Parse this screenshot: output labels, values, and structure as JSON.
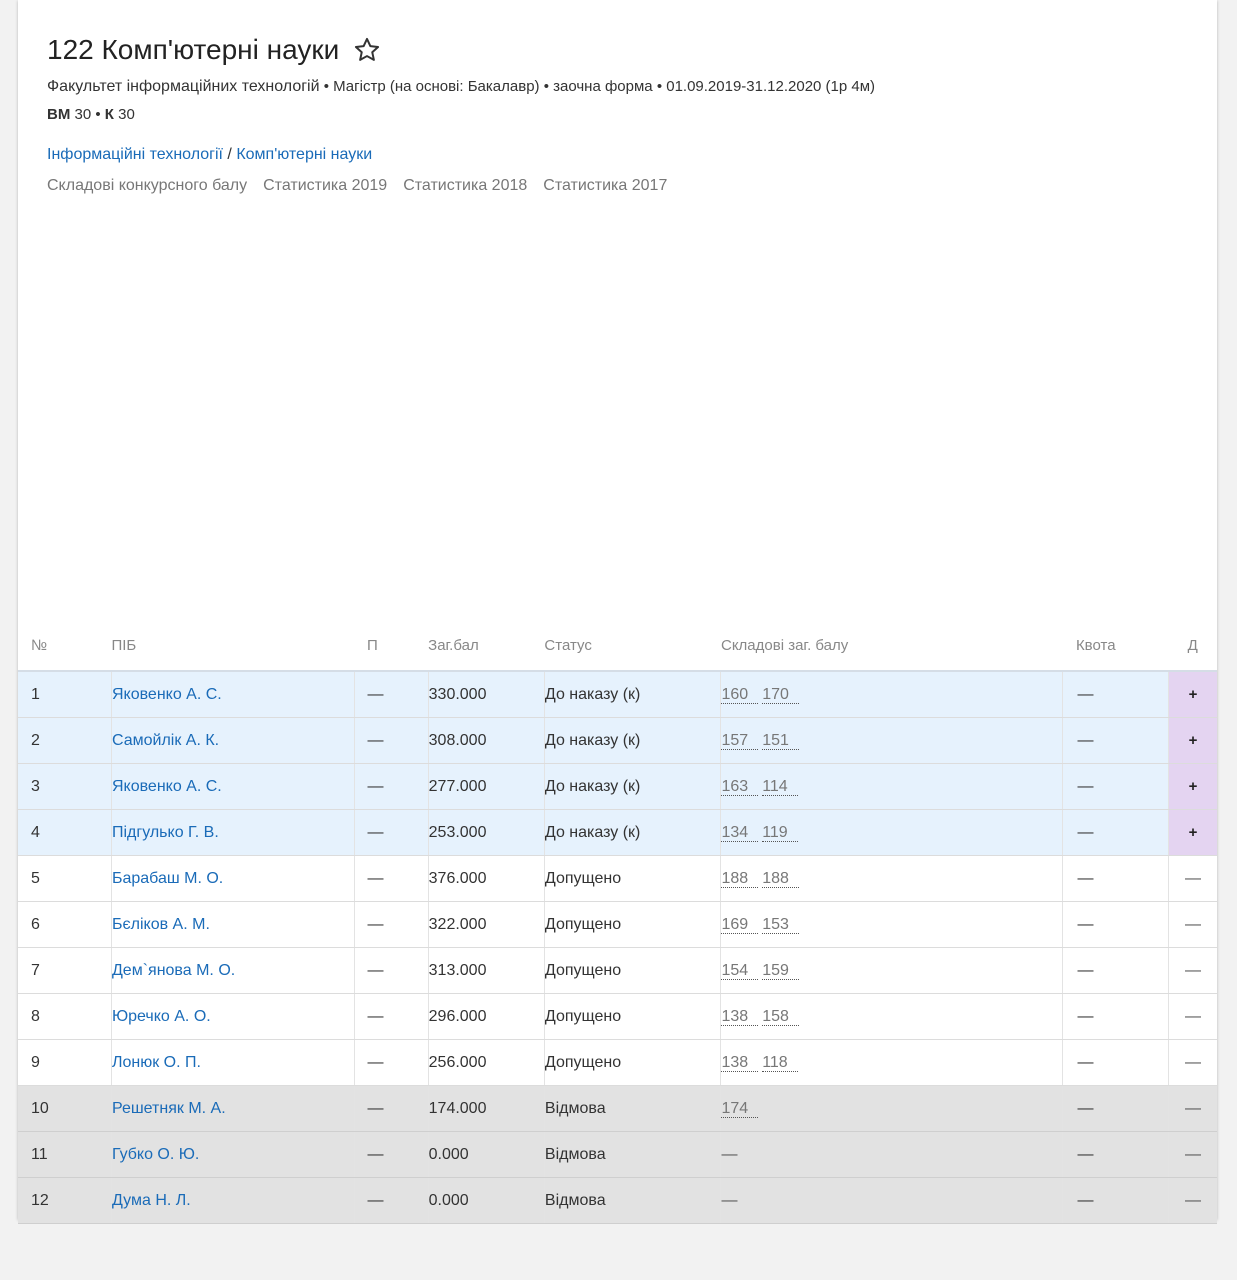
{
  "header": {
    "title": "122 Комп'ютерні науки",
    "meta_faculty": "Факультет інформаційних технологій",
    "meta_rest": " • Магістр (на основі: Бакалавр) • заочна форма • 01.09.2019-31.12.2020 (1р 4м)",
    "quota_vm_label": "ВМ",
    "quota_vm_value": " 30 • ",
    "quota_k_label": "К",
    "quota_k_value": " 30",
    "breadcrumb_1": "Інформаційні технології",
    "breadcrumb_sep": " / ",
    "breadcrumb_2": "Комп'ютерні науки",
    "tabs": [
      "Складові конкурсного балу",
      "Статистика 2019",
      "Статистика 2018",
      "Статистика 2017"
    ]
  },
  "table": {
    "columns": [
      "№",
      "ПІБ",
      "П",
      "Заг.бал",
      "Статус",
      "Складові заг. балу",
      "Квота",
      "Д"
    ],
    "rows": [
      {
        "num": "1",
        "name": "Яковенко А. С.",
        "p": "—",
        "score": "330.000",
        "status": "До наказу (к)",
        "comp": [
          "160",
          "170"
        ],
        "quota": "—",
        "d": "+"
      },
      {
        "num": "2",
        "name": "Самойлік А. К.",
        "p": "—",
        "score": "308.000",
        "status": "До наказу (к)",
        "comp": [
          "157",
          "151"
        ],
        "quota": "—",
        "d": "+"
      },
      {
        "num": "3",
        "name": "Яковенко А. С.",
        "p": "—",
        "score": "277.000",
        "status": "До наказу (к)",
        "comp": [
          "163",
          "114"
        ],
        "quota": "—",
        "d": "+"
      },
      {
        "num": "4",
        "name": "Підгулько Г. В.",
        "p": "—",
        "score": "253.000",
        "status": "До наказу (к)",
        "comp": [
          "134",
          "119"
        ],
        "quota": "—",
        "d": "+"
      },
      {
        "num": "5",
        "name": "Барабаш М. О.",
        "p": "—",
        "score": "376.000",
        "status": "Допущено",
        "comp": [
          "188",
          "188"
        ],
        "quota": "—",
        "d": "—"
      },
      {
        "num": "6",
        "name": "Бєліков А. М.",
        "p": "—",
        "score": "322.000",
        "status": "Допущено",
        "comp": [
          "169",
          "153"
        ],
        "quota": "—",
        "d": "—"
      },
      {
        "num": "7",
        "name": "Дем`янова М. О.",
        "p": "—",
        "score": "313.000",
        "status": "Допущено",
        "comp": [
          "154",
          "159"
        ],
        "quota": "—",
        "d": "—"
      },
      {
        "num": "8",
        "name": "Юречко А. О.",
        "p": "—",
        "score": "296.000",
        "status": "Допущено",
        "comp": [
          "138",
          "158"
        ],
        "quota": "—",
        "d": "—"
      },
      {
        "num": "9",
        "name": "Лонюк О. П.",
        "p": "—",
        "score": "256.000",
        "status": "Допущено",
        "comp": [
          "138",
          "118"
        ],
        "quota": "—",
        "d": "—"
      },
      {
        "num": "10",
        "name": "Решетняк М. А.",
        "p": "—",
        "score": "174.000",
        "status": "Відмова",
        "comp": [
          "174"
        ],
        "quota": "—",
        "d": "—"
      },
      {
        "num": "11",
        "name": "Губко О. Ю.",
        "p": "—",
        "score": "0.000",
        "status": "Відмова",
        "comp": [],
        "comp_empty": "—",
        "quota": "—",
        "d": "—"
      },
      {
        "num": "12",
        "name": "Дума Н. Л.",
        "p": "—",
        "score": "0.000",
        "status": "Відмова",
        "comp": [],
        "comp_empty": "—",
        "quota": "—",
        "d": "—"
      }
    ]
  },
  "colors": {
    "link": "#1a6bb8",
    "row_ordered": "#e6f2fd",
    "row_rejected": "#e2e2e2",
    "d_highlight": "#e4d4f1"
  }
}
